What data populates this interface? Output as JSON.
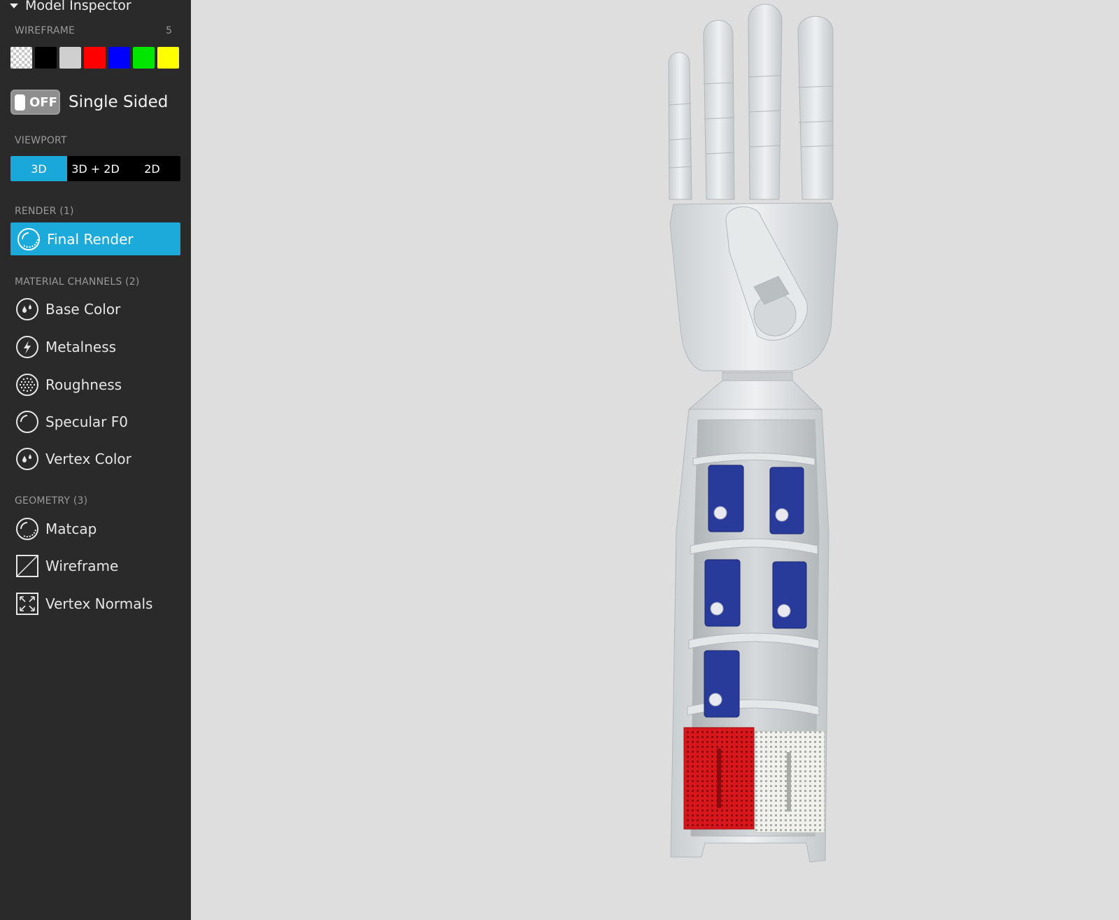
{
  "panel": {
    "title": "Model Inspector"
  },
  "wireframe": {
    "label": "WIREFRAME",
    "count": "5",
    "swatches": [
      {
        "name": "transparent",
        "color": "checker"
      },
      {
        "name": "black",
        "color": "#000000"
      },
      {
        "name": "light-gray",
        "color": "#cfcfcf"
      },
      {
        "name": "red",
        "color": "#ff0000"
      },
      {
        "name": "blue",
        "color": "#0000ff"
      },
      {
        "name": "green",
        "color": "#00e600"
      },
      {
        "name": "yellow",
        "color": "#ffff00"
      }
    ]
  },
  "single_sided": {
    "toggle_state": "OFF",
    "label": "Single Sided"
  },
  "viewport_section": {
    "label": "VIEWPORT",
    "options": [
      "3D",
      "3D + 2D",
      "2D"
    ],
    "selected": "3D"
  },
  "render": {
    "label": "RENDER (1)",
    "final_render": "Final Render"
  },
  "material_channels": {
    "label": "MATERIAL CHANNELS (2)",
    "items": [
      {
        "label": "Base Color",
        "icon": "droplet-icon"
      },
      {
        "label": "Metalness",
        "icon": "lightning-icon"
      },
      {
        "label": "Roughness",
        "icon": "dots-sphere-icon"
      },
      {
        "label": "Specular F0",
        "icon": "sphere-icon"
      },
      {
        "label": "Vertex Color",
        "icon": "droplet-icon"
      }
    ]
  },
  "geometry": {
    "label": "GEOMETRY (3)",
    "items": [
      {
        "label": "Matcap",
        "icon": "matcap-sphere-icon"
      },
      {
        "label": "Wireframe",
        "icon": "wireframe-square-icon"
      },
      {
        "label": "Vertex Normals",
        "icon": "expand-arrows-icon"
      }
    ]
  },
  "colors": {
    "accent": "#1caadb",
    "sidebar_bg": "#2a2a2a",
    "viewport_bg": "#dedede"
  }
}
